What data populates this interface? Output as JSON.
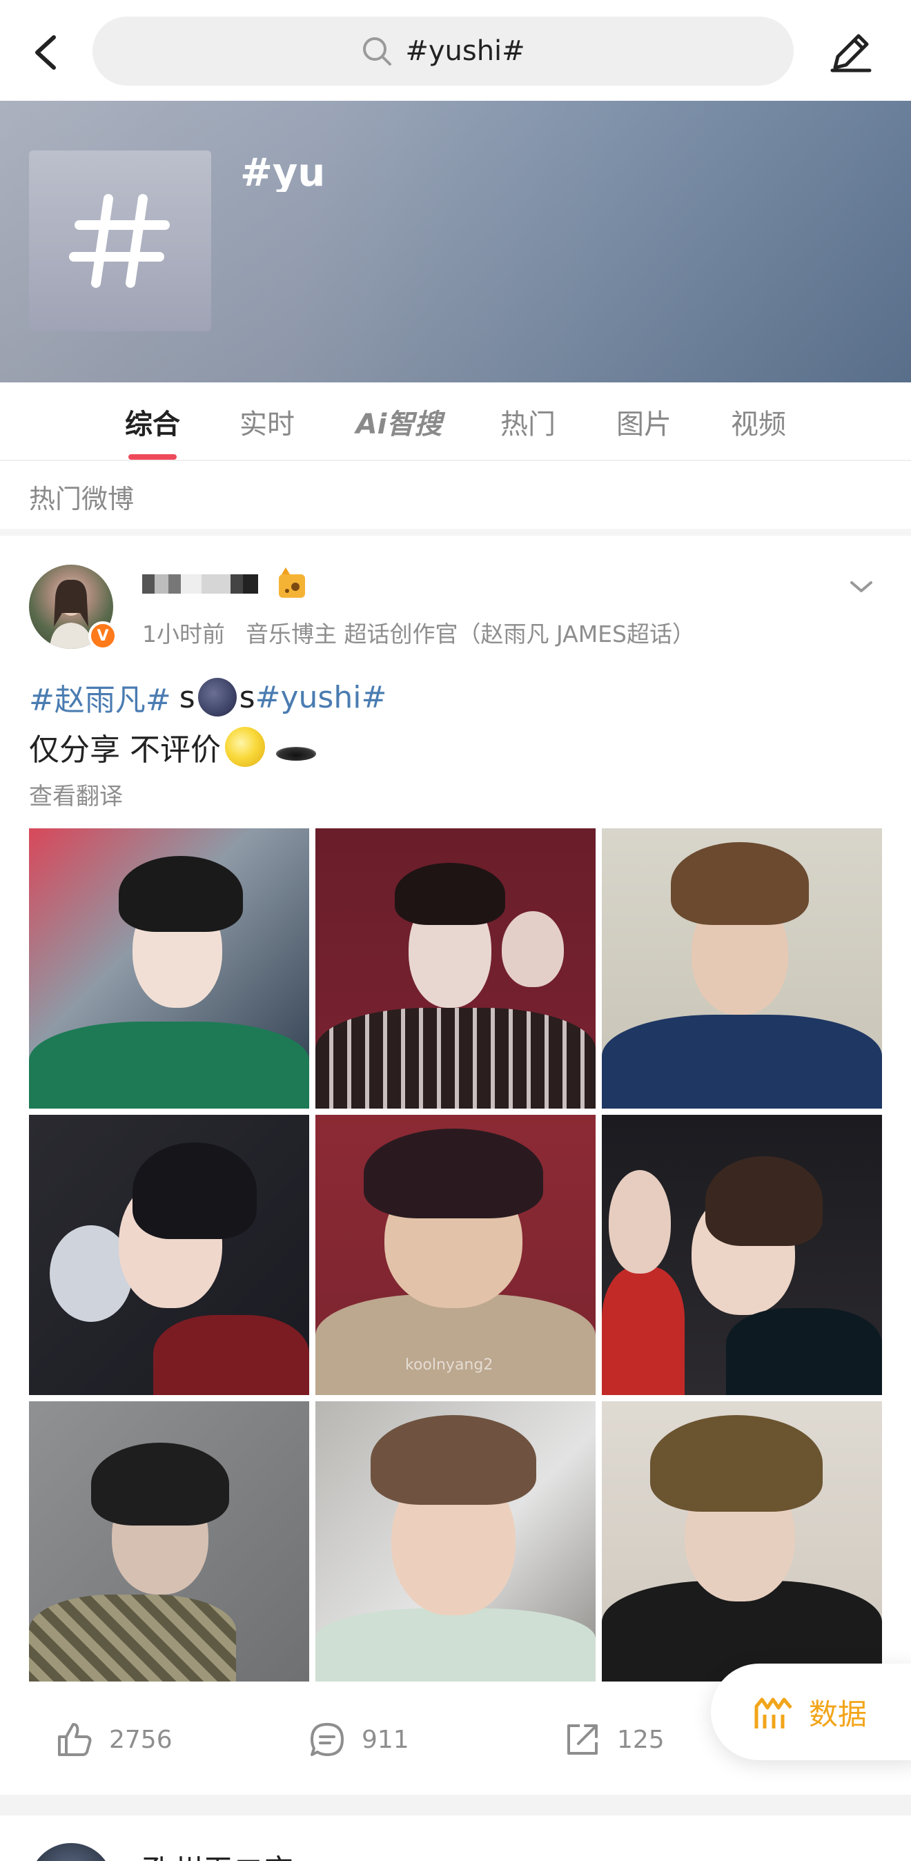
{
  "topbar": {
    "search_text": "#yushi#"
  },
  "header": {
    "title": "#yus"
  },
  "tabs": [
    {
      "label": "综合",
      "active": true
    },
    {
      "label": "实时",
      "active": false
    },
    {
      "label": "Ai智搜",
      "active": false
    },
    {
      "label": "热门",
      "active": false
    },
    {
      "label": "图片",
      "active": false
    },
    {
      "label": "视频",
      "active": false
    }
  ],
  "section": {
    "label": "热门微博"
  },
  "post": {
    "time": "1小时前",
    "role": "音乐博主 超话创作官（赵雨凡 JAMES超话）",
    "verified_mark": "V",
    "text_line1": {
      "tag1": "#赵雨凡#",
      "s1": "s",
      "s2": "s",
      "tag2": "#yushi#"
    },
    "text_line2": "仅分享 不评价",
    "translate_label": "查看翻译",
    "photo_watermark": "koolnyang2"
  },
  "actions": {
    "likes": "2756",
    "comments": "911",
    "reposts": "125",
    "data_label": "数据"
  },
  "next_post": {
    "name_partial": "孔州无二宝"
  },
  "colors": {
    "accent": "#ee4a5a",
    "link": "#4a7cb1",
    "data": "#f2a51a"
  }
}
